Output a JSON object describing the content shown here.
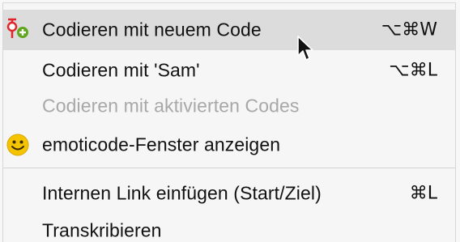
{
  "menu": {
    "items": [
      {
        "label": "Codieren mit neuem Code",
        "shortcut": "⌥⌘W",
        "icon": "code-plus-icon",
        "state": "hover"
      },
      {
        "label": "Codieren mit 'Sam'",
        "shortcut": "⌥⌘L",
        "icon": "",
        "state": "normal"
      },
      {
        "label": "Codieren mit aktivierten Codes",
        "shortcut": "",
        "icon": "",
        "state": "disabled"
      },
      {
        "label": "emoticode-Fenster anzeigen",
        "shortcut": "",
        "icon": "smiley-icon",
        "state": "normal"
      },
      {
        "label": "Internen Link einfügen (Start/Ziel)",
        "shortcut": "⌘L",
        "icon": "",
        "state": "normal"
      },
      {
        "label": "Transkribieren",
        "shortcut": "",
        "icon": "",
        "state": "normal"
      }
    ]
  },
  "colors": {
    "hover_bg": "#dcdcdc",
    "disabled_text": "#a8a8a8",
    "code_red": "#e0262b",
    "plus_green": "#5fa81e",
    "smiley_yellow": "#f5c400"
  }
}
